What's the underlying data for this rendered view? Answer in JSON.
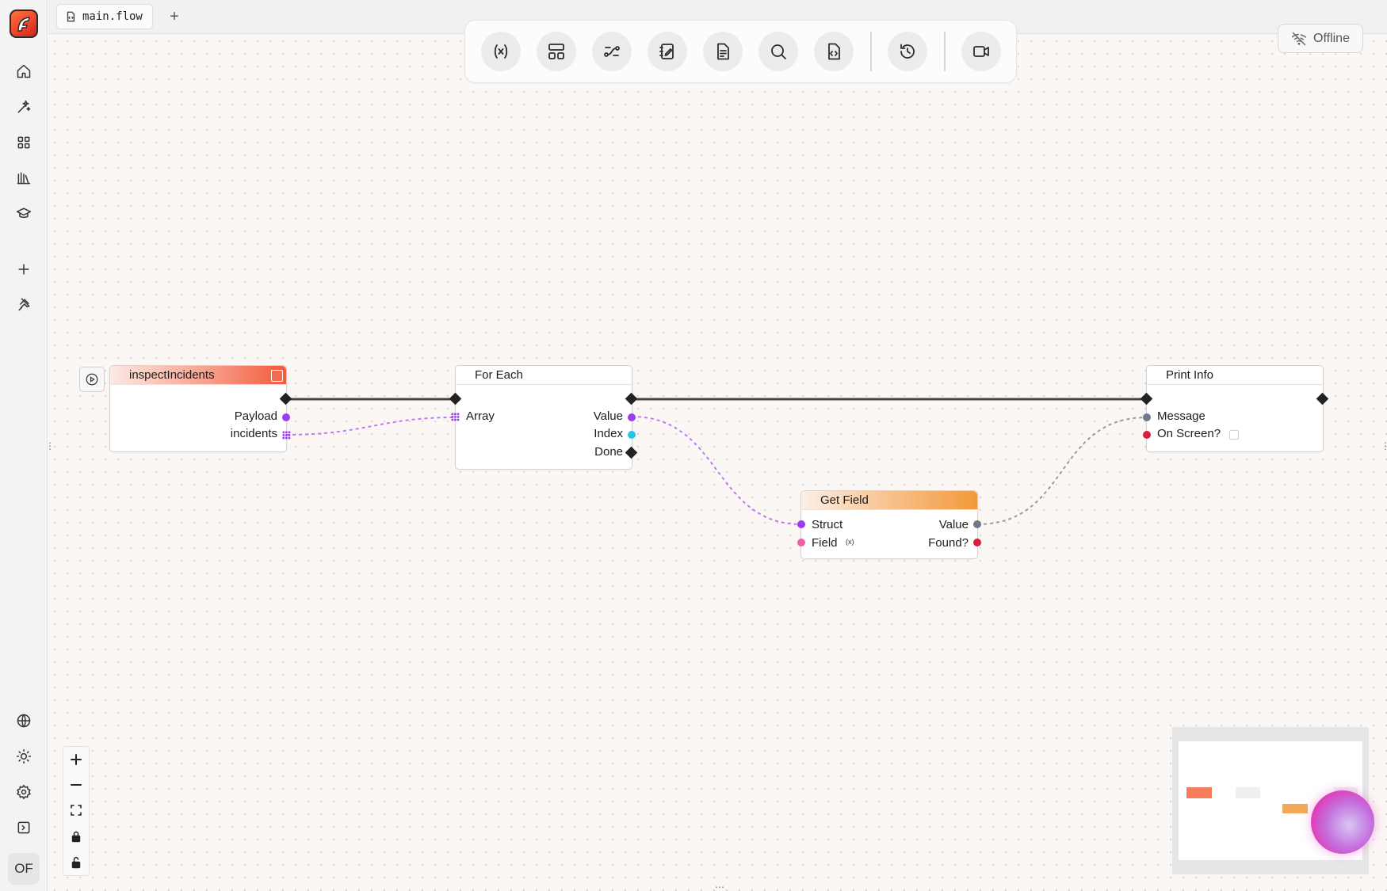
{
  "tabs": {
    "active": "main.flow",
    "add_label": "+"
  },
  "status": {
    "offline_label": "Offline"
  },
  "user": {
    "initials": "OF"
  },
  "toolbar": {
    "buttons": [
      "variable-icon",
      "layout-icon",
      "connections-icon",
      "notes-icon",
      "document-icon",
      "search-icon",
      "code-file-icon",
      "history-icon",
      "video-icon"
    ]
  },
  "sidebar": {
    "top_icons": [
      "home-icon",
      "sparkle-icon",
      "grid-icon",
      "library-icon",
      "graduation-cap-icon",
      "plus-icon",
      "pin-icon"
    ],
    "bottom_icons": [
      "globe-icon",
      "sun-icon",
      "gear-icon",
      "panel-icon"
    ]
  },
  "nodes": {
    "inspect": {
      "title": "inspectIncidents",
      "outputs": [
        "Payload",
        "incidents"
      ],
      "accent": "#f25a3d"
    },
    "foreach": {
      "title": "For Each",
      "inputs": [
        "Array"
      ],
      "outputs": [
        "Value",
        "Index",
        "Done"
      ]
    },
    "print": {
      "title": "Print Info",
      "inputs": [
        "Message",
        "On Screen?"
      ]
    },
    "getfield": {
      "title": "Get Field",
      "inputs": [
        "Struct",
        "Field"
      ],
      "outputs": [
        "Value",
        "Found?"
      ],
      "accent": "#f29a3a",
      "field_badge": "(x)"
    }
  },
  "colors": {
    "exec_wire": "#444444",
    "struct_wire": "#c07af0",
    "value_wire": "#9a9a9a",
    "purple_pin": "#9d3cf0",
    "cyan_pin": "#27c4e6",
    "slate_pin": "#6b7b8c",
    "red_pin": "#d4203e",
    "pink_pin": "#ec5fa5"
  }
}
